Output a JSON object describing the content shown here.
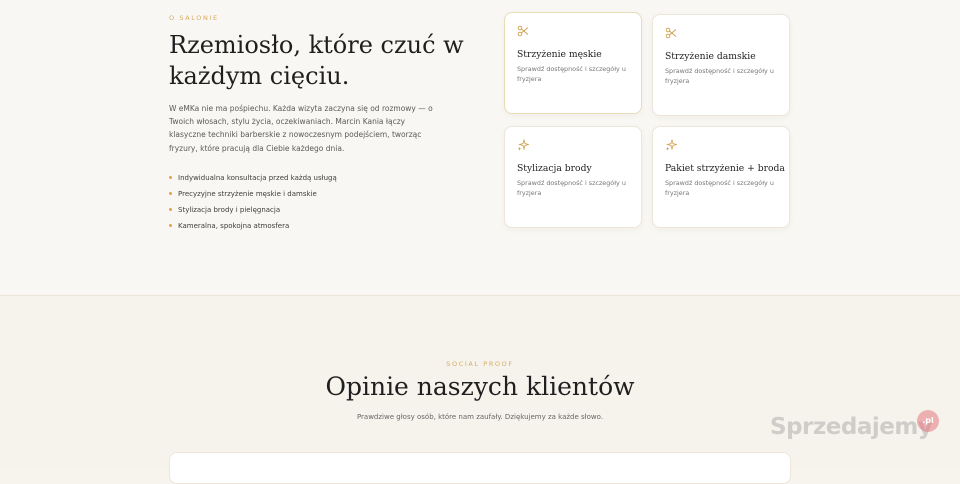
{
  "about": {
    "eyebrow": "O SALONIE",
    "title": "Rzemiosło, które czuć w każdym cięciu.",
    "description": "W eMKa nie ma pośpiechu. Każda wizyta zaczyna się od rozmowy — o Twoich włosach, stylu życia, oczekiwaniach. Marcin Kania łączy klasyczne techniki barberskie z nowoczesnym podejściem, tworząc fryzury, które pracują dla Ciebie każdego dnia.",
    "features": [
      "Indywidualna konsultacja przed każdą usługą",
      "Precyzyjne strzyżenie męskie i damskie",
      "Stylizacja brody i pielęgnacja",
      "Kameralna, spokojna atmosfera"
    ]
  },
  "services": [
    {
      "title": "Strzyżenie męskie",
      "desc": "Sprawdź dostępność i szczegóły u fryzjera",
      "icon": "scissors-icon"
    },
    {
      "title": "Strzyżenie damskie",
      "desc": "Sprawdź dostępność i szczegóły u fryzjera",
      "icon": "scissors-icon"
    },
    {
      "title": "Stylizacja brody",
      "desc": "Sprawdź dostępność i szczegóły u fryzjera",
      "icon": "sparkle-icon"
    },
    {
      "title": "Pakiet strzyżenie + broda",
      "desc": "Sprawdź dostępność i szczegóły u fryzjera",
      "icon": "sparkle-icon"
    }
  ],
  "reviews": {
    "eyebrow": "SOCIAL PROOF",
    "title": "Opinie naszych klientów",
    "subtitle": "Prawdziwe głosy osób, które nam zaufały. Dziękujemy za każde słowo."
  },
  "watermark": {
    "text": "Sprzedajemy",
    "badge": ".pl"
  },
  "colors": {
    "accent": "#d5ad62",
    "background": "#f9f7f3"
  }
}
